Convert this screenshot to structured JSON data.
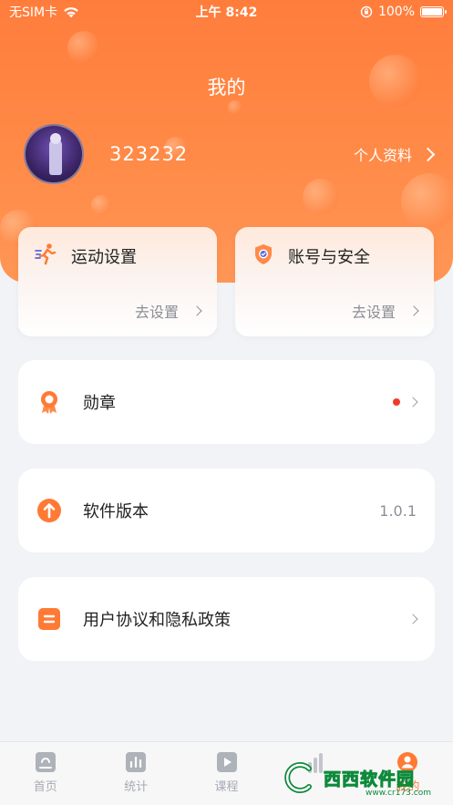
{
  "status_bar": {
    "carrier": "无SIM卡",
    "time": "上午 8:42",
    "battery": "100%"
  },
  "header": {
    "title": "我的",
    "username": "323232",
    "profile_link": "个人资料"
  },
  "quick_cards": [
    {
      "title": "运动设置",
      "action": "去设置",
      "icon": "running-person-icon"
    },
    {
      "title": "账号与安全",
      "action": "去设置",
      "icon": "security-shield-icon"
    }
  ],
  "menu": {
    "badge": {
      "label": "勋章",
      "has_new": true
    },
    "version": {
      "label": "软件版本",
      "value": "1.0.1"
    },
    "agreement": {
      "label": "用户协议和隐私政策"
    }
  },
  "tabbar": {
    "items": [
      {
        "label": "首页",
        "icon": "home-icon",
        "active": false
      },
      {
        "label": "统计",
        "icon": "stats-icon",
        "active": false
      },
      {
        "label": "课程",
        "icon": "play-icon",
        "active": false
      },
      {
        "label": "",
        "icon": "bar-icon",
        "active": false
      },
      {
        "label": "我的",
        "icon": "profile-icon",
        "active": true
      }
    ]
  },
  "watermark": {
    "text": "西西软件园",
    "sub": "www.cr173.com"
  },
  "colors": {
    "accent": "#ff7a35",
    "hero": "#ff8a47",
    "background": "#f1f3f6"
  }
}
